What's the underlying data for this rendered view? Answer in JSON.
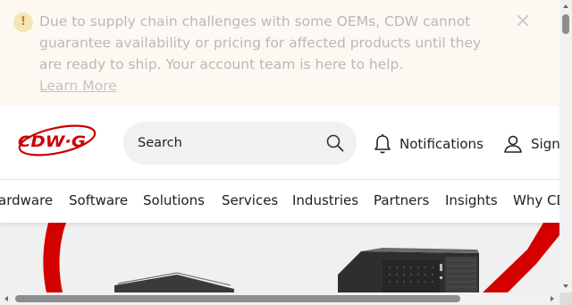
{
  "alert": {
    "message": "Due to supply chain challenges with some OEMs, CDW cannot guarantee availability or pricing for affected products until they are ready to ship. Your account team is here to help.",
    "link_label": "Learn More",
    "icon": "exclamation-icon",
    "close_icon": "close-icon"
  },
  "header": {
    "logo_text": "CDW·G",
    "search": {
      "placeholder": "Search",
      "icon": "search-icon"
    },
    "notifications_label": "Notifications",
    "signin_label": "Sign"
  },
  "nav": {
    "items": [
      {
        "label": "ardware"
      },
      {
        "label": "Software"
      },
      {
        "label": "Solutions"
      },
      {
        "label": "Services"
      },
      {
        "label": "Industries"
      },
      {
        "label": "Partners"
      },
      {
        "label": "Insights"
      },
      {
        "label": "Why CD"
      }
    ]
  },
  "colors": {
    "brand_red": "#cc0000",
    "alert_bg": "#fdf9f2",
    "alert_icon_bg": "#f6e5b8"
  }
}
